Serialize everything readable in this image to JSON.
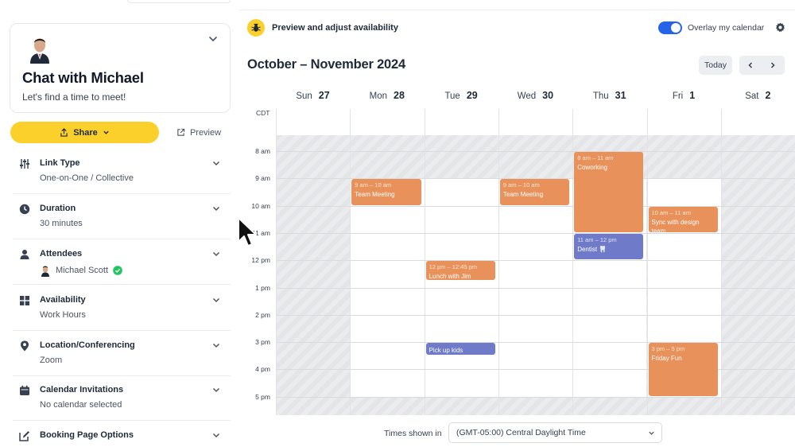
{
  "sidebar": {
    "profile": {
      "title": "Chat with Michael",
      "subtitle": "Let's find a time to meet!"
    },
    "share_label": "Share",
    "preview_label": "Preview",
    "settings": [
      {
        "title": "Link Type",
        "value": "One-on-One / Collective",
        "icon": "sliders-icon"
      },
      {
        "title": "Duration",
        "value": "30 minutes",
        "icon": "clock-icon"
      },
      {
        "title": "Attendees",
        "value": "Michael Scott",
        "icon": "user-icon"
      },
      {
        "title": "Availability",
        "value": "Work Hours",
        "icon": "grid-icon"
      },
      {
        "title": "Location/Conferencing",
        "value": "Zoom",
        "icon": "location-pin-icon"
      },
      {
        "title": "Calendar Invitations",
        "value": "No calendar selected",
        "icon": "calendar-icon"
      },
      {
        "title": "Booking Page Options",
        "value": "",
        "icon": "edit-icon"
      }
    ]
  },
  "header": {
    "title": "Preview and adjust availability",
    "overlay_label": "Overlay my calendar",
    "overlay_on": true
  },
  "calendar": {
    "range_title": "October – November 2024",
    "today_label": "Today",
    "timezone_short": "CDT",
    "days": [
      {
        "name": "Sun",
        "date": "27"
      },
      {
        "name": "Mon",
        "date": "28"
      },
      {
        "name": "Tue",
        "date": "29"
      },
      {
        "name": "Wed",
        "date": "30"
      },
      {
        "name": "Thu",
        "date": "31"
      },
      {
        "name": "Fri",
        "date": "1"
      },
      {
        "name": "Sat",
        "date": "2"
      }
    ],
    "hours": [
      "8 am",
      "9 am",
      "10 am",
      "11 am",
      "12 pm",
      "1 pm",
      "2 pm",
      "3 pm",
      "4 pm",
      "5 pm"
    ],
    "events": [
      {
        "day": 1,
        "start": 9,
        "end": 10,
        "time": "9 am – 10 am",
        "title": "Team Meeting",
        "color": "orange"
      },
      {
        "day": 3,
        "start": 9,
        "end": 10,
        "time": "9 am – 10 am",
        "title": "Team Meeting",
        "color": "orange"
      },
      {
        "day": 4,
        "start": 8,
        "end": 11,
        "time": "8 am – 11 am",
        "title": "Coworking",
        "color": "orange"
      },
      {
        "day": 4,
        "start": 11,
        "end": 12,
        "time": "11 am – 12 pm",
        "title": "Dentist 🦷",
        "color": "blue"
      },
      {
        "day": 5,
        "start": 10,
        "end": 11,
        "time": "10 am – 11 am",
        "title": "Sync with design team",
        "color": "orange"
      },
      {
        "day": 2,
        "start": 12,
        "end": 12.75,
        "time": "12 pm – 12:45 pm",
        "title": "Lunch with Jim",
        "color": "orange"
      },
      {
        "day": 2,
        "start": 15,
        "end": 15.5,
        "time": "",
        "title": "Pick up kids",
        "color": "blue"
      },
      {
        "day": 5,
        "start": 15,
        "end": 17,
        "time": "3 pm – 5 pm",
        "title": "Friday Fun",
        "color": "orange"
      }
    ]
  },
  "footer": {
    "times_label": "Times shown in",
    "timezone_value": "(GMT-05:00) Central Daylight Time"
  },
  "colors": {
    "accent_yellow": "#fbd02b",
    "toggle_blue": "#2563eb",
    "event_orange": "#e8915a",
    "event_blue": "#6f7bc8"
  }
}
